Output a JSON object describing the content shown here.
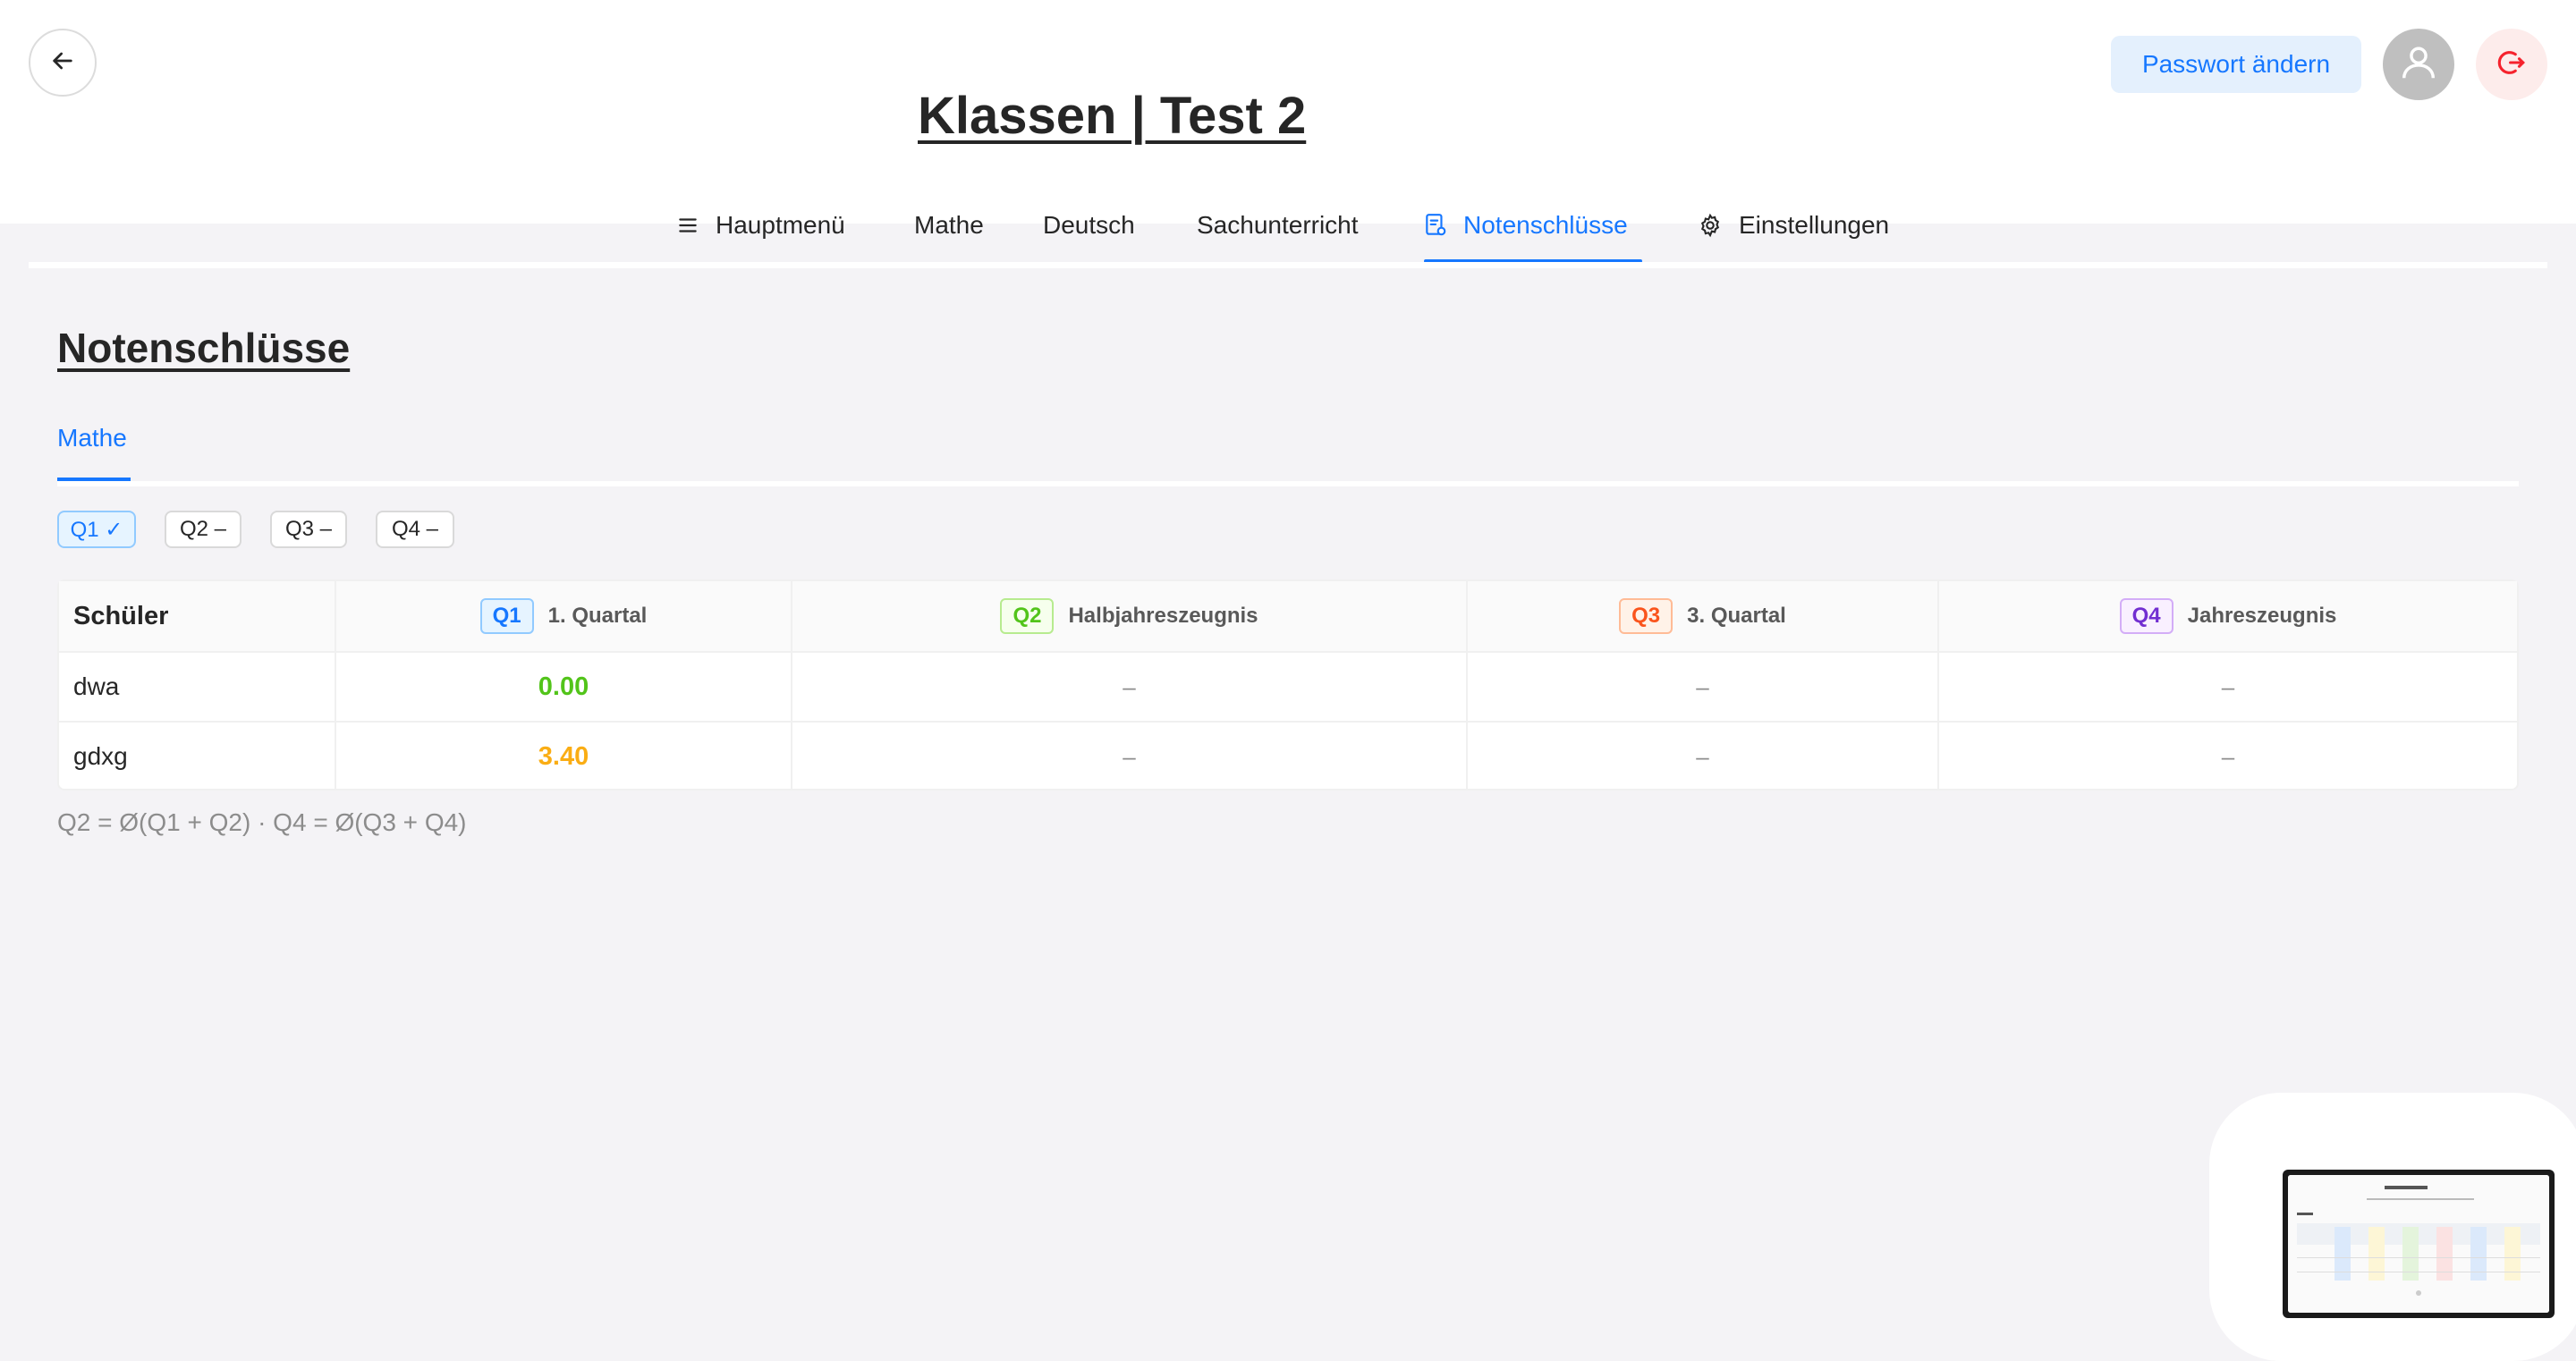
{
  "header": {
    "title": "Klassen | Test 2",
    "password_button": "Passwort ändern"
  },
  "nav": {
    "items": [
      {
        "label": "Hauptmenü",
        "icon": "menu-icon"
      },
      {
        "label": "Mathe"
      },
      {
        "label": "Deutsch"
      },
      {
        "label": "Sachunterricht"
      },
      {
        "label": "Notenschlüsse",
        "icon": "report-icon",
        "active": true
      },
      {
        "label": "Einstellungen",
        "icon": "gear-icon"
      }
    ]
  },
  "section": {
    "title": "Notenschlüsse",
    "subject_tab": "Mathe"
  },
  "quarter_chips": [
    {
      "label": "Q1 ✓",
      "active": true
    },
    {
      "label": "Q2 –"
    },
    {
      "label": "Q3 –"
    },
    {
      "label": "Q4 –"
    }
  ],
  "table": {
    "student_header": "Schüler",
    "columns": [
      {
        "tag": "Q1",
        "label": "1. Quartal",
        "color": "#1677ff",
        "bg": "#e6f4ff",
        "border": "#91caff"
      },
      {
        "tag": "Q2",
        "label": "Halbjahreszeugnis",
        "color": "#52c41a",
        "bg": "#f6ffed",
        "border": "#b7eb8f"
      },
      {
        "tag": "Q3",
        "label": "3. Quartal",
        "color": "#fa541c",
        "bg": "#fff2e8",
        "border": "#ffbb96"
      },
      {
        "tag": "Q4",
        "label": "Jahreszeugnis",
        "color": "#722ed1",
        "bg": "#f9f0ff",
        "border": "#d3adf7"
      }
    ],
    "rows": [
      {
        "student": "dwa",
        "q1": "0.00",
        "q1_color": "#52c41a",
        "q2": "–",
        "q3": "–",
        "q4": "–"
      },
      {
        "student": "gdxg",
        "q1": "3.40",
        "q1_color": "#faad14",
        "q2": "–",
        "q3": "–",
        "q4": "–"
      }
    ]
  },
  "formula": "Q2 = Ø(Q1 + Q2) · Q4 = Ø(Q3 + Q4)",
  "colors": {
    "accent": "#1677ff",
    "logout": "#f5222d"
  }
}
